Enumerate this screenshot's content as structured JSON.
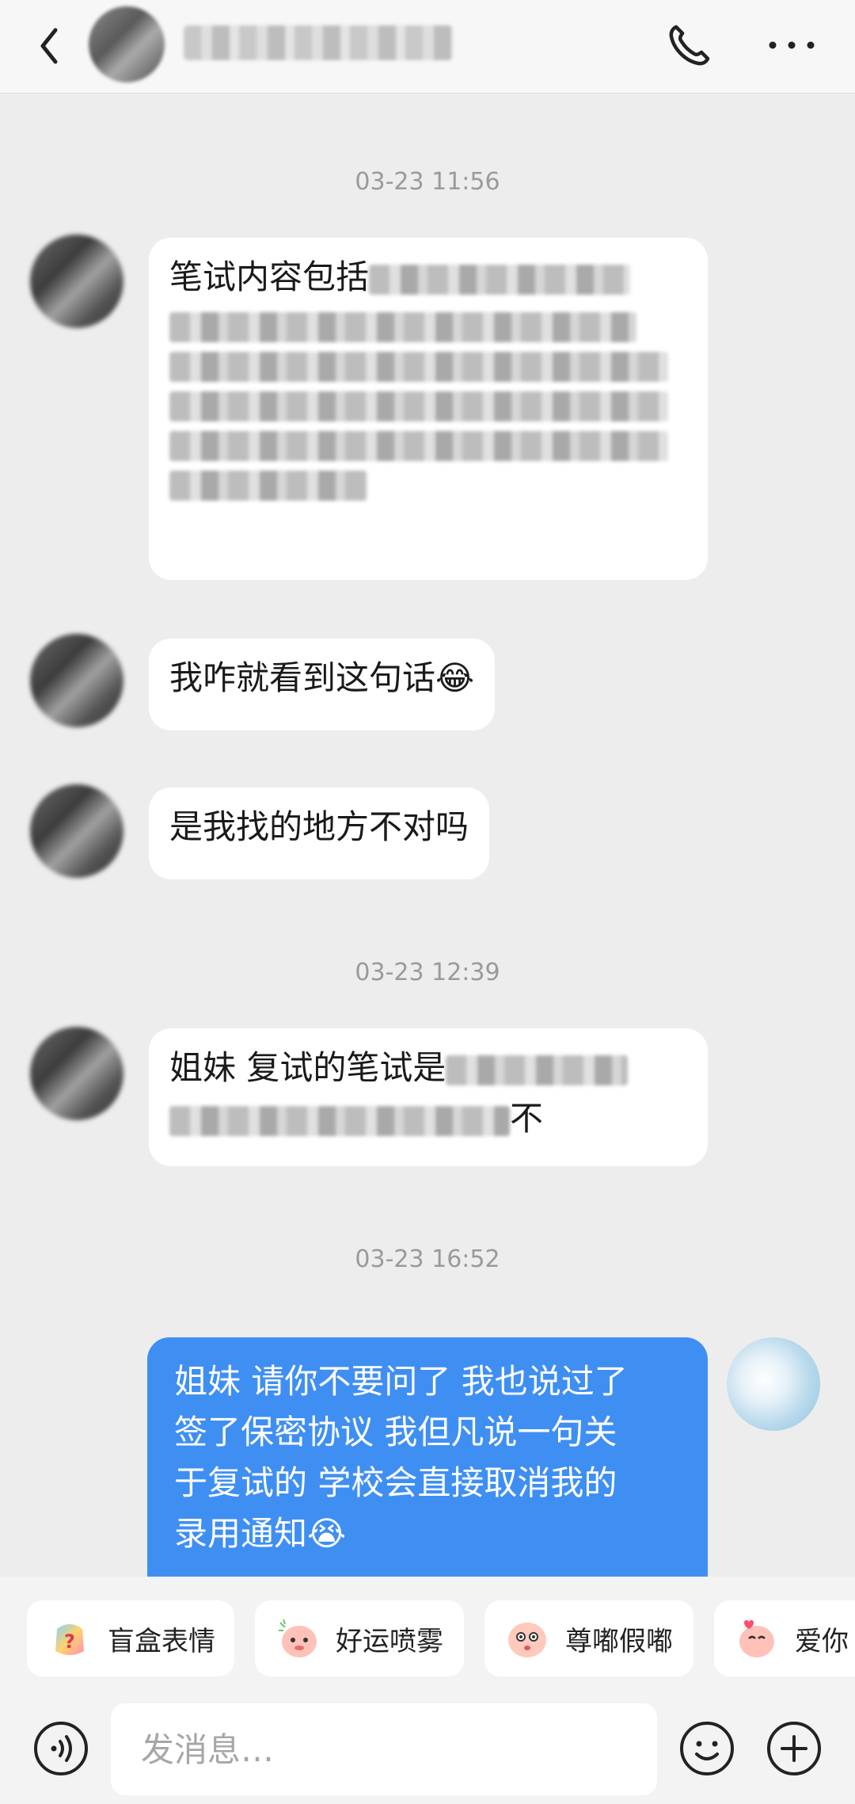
{
  "header": {
    "back_icon": "chevron-left-icon",
    "call_icon": "phone-icon",
    "more_icon": "more-dots-icon"
  },
  "timestamps": [
    "03-23 11:56",
    "03-23 12:39",
    "03-23 16:52"
  ],
  "messages": [
    {
      "direction": "in",
      "text_visible": "笔试内容包括"
    },
    {
      "direction": "in",
      "text": "我咋就看到这句话😂"
    },
    {
      "direction": "in",
      "text": "是我找的地方不对吗"
    },
    {
      "direction": "in",
      "text_visible": "姐妹 复试的笔试是",
      "tail_visible": "不"
    },
    {
      "direction": "out",
      "lines": [
        "姐妹 请你不要问了 我也说过了",
        "签了保密协议 我但凡说一句关",
        "于复试的 学校会直接取消我的",
        "录用通知😭"
      ]
    }
  ],
  "stickers": [
    {
      "label": "盲盒表情",
      "icon": "blind-box-sticker-icon"
    },
    {
      "label": "好运喷雾",
      "icon": "lucky-spray-sticker-icon"
    },
    {
      "label": "尊嘟假嘟",
      "icon": "really-sticker-icon"
    },
    {
      "label": "爱你",
      "icon": "love-you-sticker-icon"
    }
  ],
  "input": {
    "placeholder": "发消息…",
    "voice_icon": "voice-icon",
    "emoji_icon": "emoji-icon",
    "plus_icon": "plus-icon"
  },
  "colors": {
    "background": "#ededed",
    "outgoing_bubble": "#3f8ff3",
    "incoming_bubble": "#ffffff",
    "timestamp": "#9a9a9a"
  }
}
